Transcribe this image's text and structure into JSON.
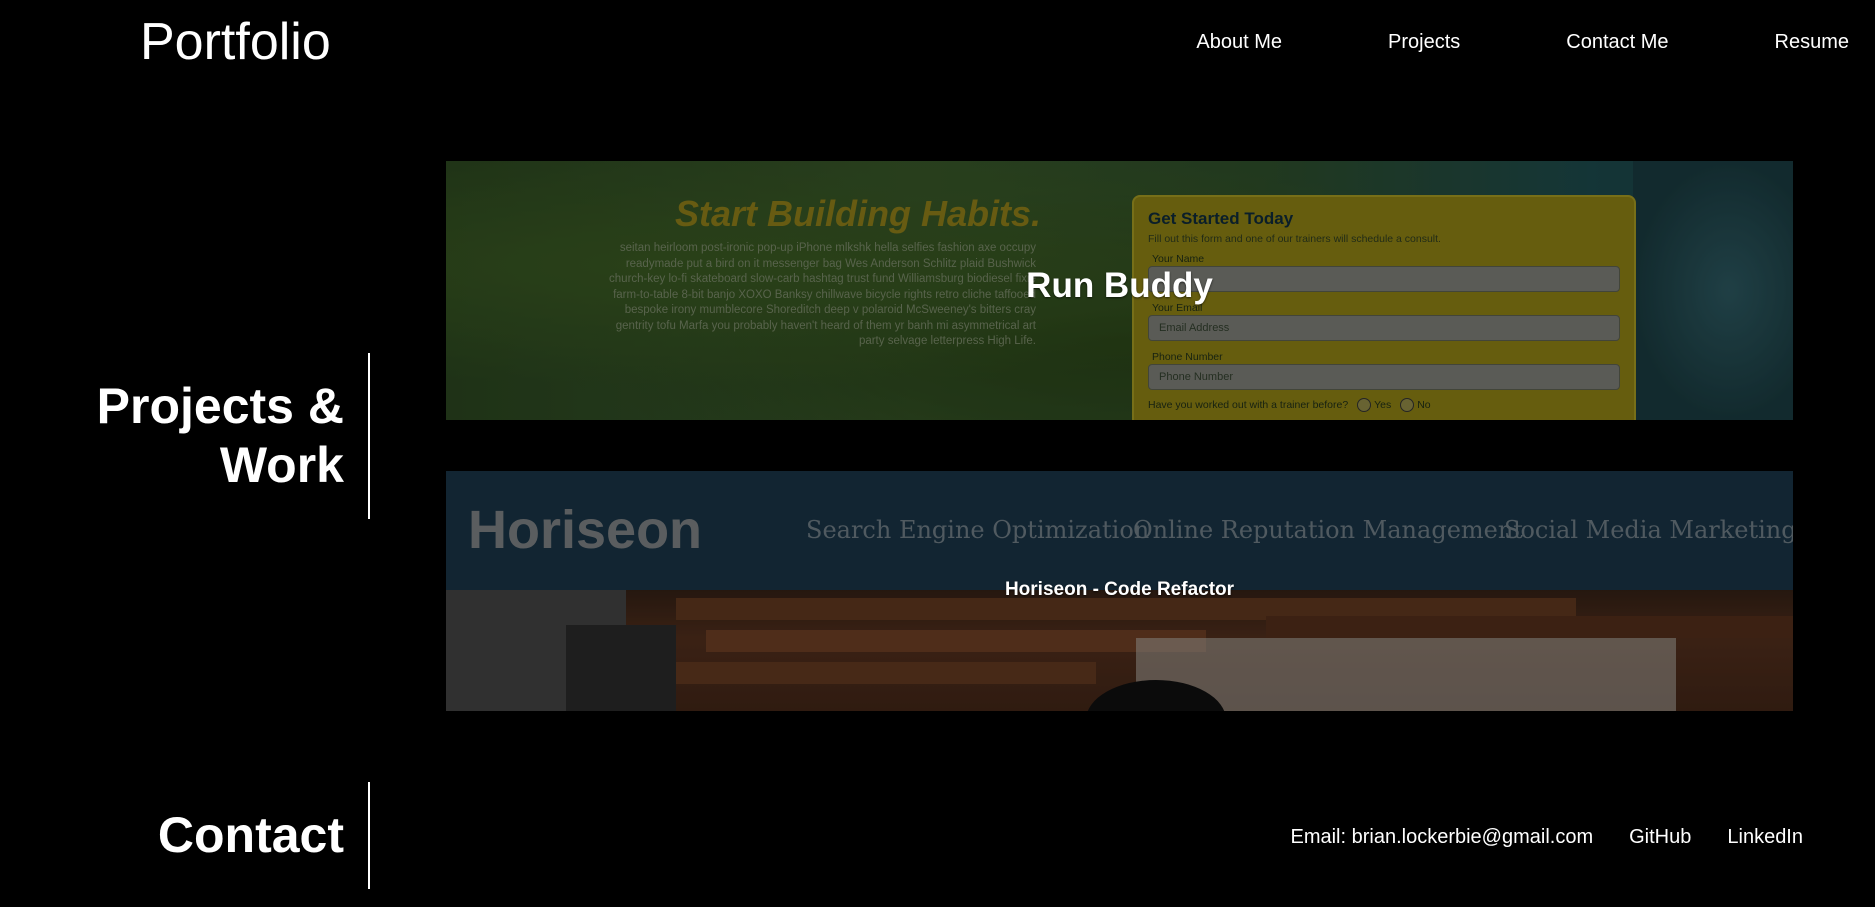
{
  "header": {
    "title": "Portfolio",
    "nav": [
      "About Me",
      "Projects",
      "Contact Me",
      "Resume"
    ]
  },
  "projects_section": {
    "heading_line1": "Projects &",
    "heading_line2": "Work",
    "items": [
      {
        "title": "Run Buddy",
        "preview": {
          "headline": "Start Building Habits.",
          "body": "seitan heirloom post-ironic pop-up iPhone mlkshk hella selfies fashion axe occupy readymade put a bird on it messenger bag Wes Anderson Schlitz plaid Bushwick church-key lo-fi skateboard slow-carb hashtag trust fund Williamsburg biodiesel fixie farm-to-table 8-bit banjo XOXO Banksy chillwave bicycle rights retro cliche taffooed bespoke irony mumblecore Shoreditch deep v polaroid McSweeney's bitters cray gentrity tofu Marfa you probably haven't heard of them yr banh mi asymmetrical art party selvage letterpress High Life.",
          "form_title": "Get Started Today",
          "form_subtitle": "Fill out this form and one of our trainers will schedule a consult.",
          "name_label": "Your Name",
          "email_label": "Your Email",
          "email_placeholder": "Email Address",
          "phone_label": "Phone Number",
          "phone_placeholder": "Phone Number",
          "question": "Have you worked out with a trainer before?",
          "yes": "Yes",
          "no": "No"
        }
      },
      {
        "title": "Horiseon - Code Refactor",
        "preview": {
          "logo": "Horiseon",
          "links": [
            "Search Engine Optimization",
            "Online Reputation Management",
            "Social Media Marketing"
          ]
        }
      }
    ]
  },
  "contact_section": {
    "heading": "Contact",
    "email": "Email: brian.lockerbie@gmail.com",
    "github": "GitHub",
    "linkedin": "LinkedIn"
  }
}
